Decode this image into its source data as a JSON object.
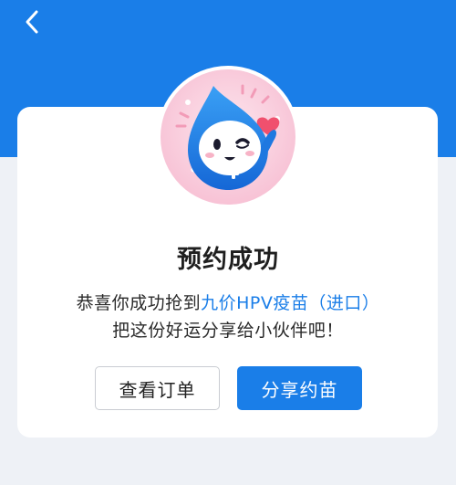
{
  "colors": {
    "header": "#1a7ee8",
    "accent": "#1a7ee8",
    "card": "#ffffff",
    "page_bg": "#eef1f6"
  },
  "header": {
    "back_icon": "chevron-left-icon"
  },
  "avatar": {
    "icon": "water-drop-mascot-icon",
    "accents": [
      "heart-icon",
      "medical-cross-icon"
    ]
  },
  "dialog": {
    "title": "预约成功",
    "message_line1_prefix": "恭喜你成功抢到",
    "message_line1_highlight": "九价HPV疫苗（进口）",
    "message_line2": "把这份好运分享给小伙伴吧！",
    "secondary_button": "查看订单",
    "primary_button": "分享约苗"
  }
}
